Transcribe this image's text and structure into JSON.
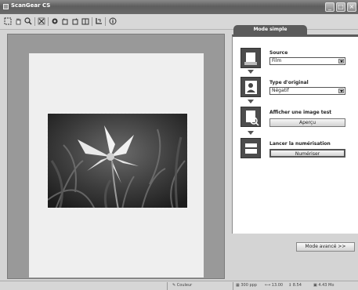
{
  "window": {
    "title": "ScanGear CS"
  },
  "titlebar": {
    "minimize_glyph": "_",
    "maximize_glyph": "□",
    "close_glyph": "×"
  },
  "toolbar": {
    "icons": [
      "select-frame-icon",
      "hand-icon",
      "zoom-icon",
      "auto-crop-icon",
      "remove-frame-icon",
      "rotate-left-icon",
      "rotate-right-icon",
      "mirror-icon",
      "multi-crop-icon",
      "info-icon"
    ]
  },
  "simple_mode": {
    "tab_label": "Mode simple",
    "steps": {
      "source": {
        "label": "Source",
        "value": "Film"
      },
      "original_type": {
        "label": "Type d'original",
        "value": "Négatif"
      },
      "preview": {
        "label": "Afficher une image test",
        "button": "Aperçu"
      },
      "scan": {
        "label": "Lancer la numérisation",
        "button": "Numériser"
      }
    },
    "advanced_button": "Mode avancé >>"
  },
  "statusbar": {
    "color_mode": "Couleur",
    "resolution": "300 ppp",
    "width": "13.00",
    "height": "8.54",
    "size": "4.43 Mo"
  }
}
